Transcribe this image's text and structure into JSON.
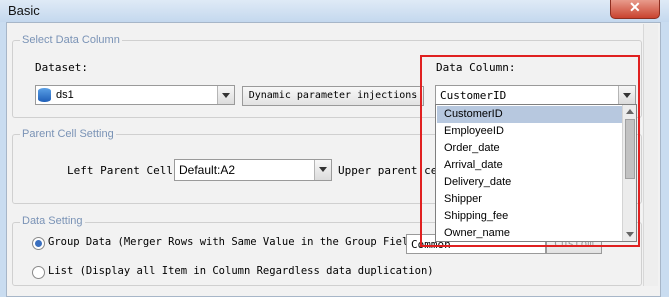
{
  "window": {
    "title": "Basic",
    "close_glyph": "✕"
  },
  "select_data_column": {
    "legend": "Select Data Column",
    "dataset_label": "Dataset:",
    "dataset_value": "ds1",
    "dynamic_button": "Dynamic parameter injections",
    "data_column_label": "Data Column:",
    "data_column_value": "CustomerID",
    "options": [
      "CustomerID",
      "EmployeeID",
      "Order_date",
      "Arrival_date",
      "Delivery_date",
      "Shipper",
      "Shipping_fee",
      "Owner_name"
    ],
    "selected_index": 0
  },
  "parent_cell_setting": {
    "legend": "Parent Cell Setting",
    "left_label": "Left Parent Cell:",
    "left_value": "Default:A2",
    "upper_label": "Upper parent ce"
  },
  "data_setting": {
    "legend": "Data Setting",
    "group_label": "Group Data (Merger Rows with Same Value in the Group Field)",
    "group_mode_value": "Common",
    "custom_button": "Custom",
    "list_label": "List (Display all Item in Column Regardless data duplication)",
    "selected": "group"
  },
  "colors": {
    "highlight": "#e02020",
    "selected_row": "#b7c8df"
  }
}
